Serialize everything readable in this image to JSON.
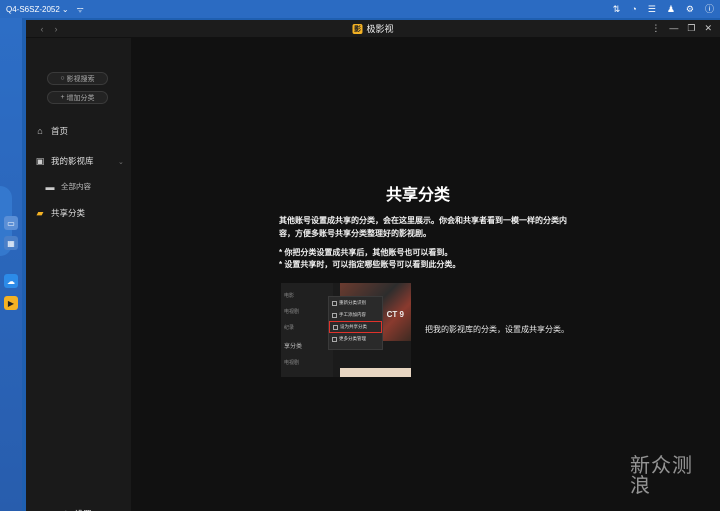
{
  "taskbar": {
    "nas_name": "Q4-S6SZ-2052",
    "icons": [
      "wifi-icon",
      "transfer-icon",
      "speedometer-icon",
      "list-icon",
      "user-icon",
      "gear-icon",
      "info-icon"
    ]
  },
  "window": {
    "title": "极影视",
    "logo_glyph": "影",
    "controls": [
      "⋮",
      "—",
      "❐",
      "✕"
    ]
  },
  "sidebar": {
    "search_label": "影视搜索",
    "add_category_label": "增加分类",
    "home_label": "首页",
    "library_label": "我的影视库",
    "all_content_label": "全部内容",
    "shared_label": "共享分类",
    "settings_label": "设置"
  },
  "main": {
    "headline": "共享分类",
    "desc_lines": [
      "其他账号设置成共享的分类，会在这里展示。你会和共享者看到一模一样的分类内",
      "容，方便多账号共享分类整理好的影视剧。"
    ],
    "tips": [
      "* 你把分类设置成共享后，其他账号也可以看到。",
      "* 设置共享时，可以指定哪些账号可以看到此分类。"
    ],
    "preview": {
      "list_items": [
        "电影",
        "电视剧",
        "纪录",
        "享分类",
        "电视剧"
      ],
      "menu_items": [
        "重新分类识别",
        "手工添加内容",
        "设为共享分类",
        "更多分类管理"
      ],
      "poster_text": "CT 9"
    },
    "caption": "把我的影视库的分类，设置成共享分类。"
  },
  "watermark": {
    "line1": "新",
    "line2": "浪",
    "brand": "众测"
  },
  "colors": {
    "desktop": "#1f5fb0",
    "window_bg": "#111111",
    "sidebar_bg": "#1a1a1a",
    "accent": "#f4b224",
    "highlight": "#e0322b"
  }
}
